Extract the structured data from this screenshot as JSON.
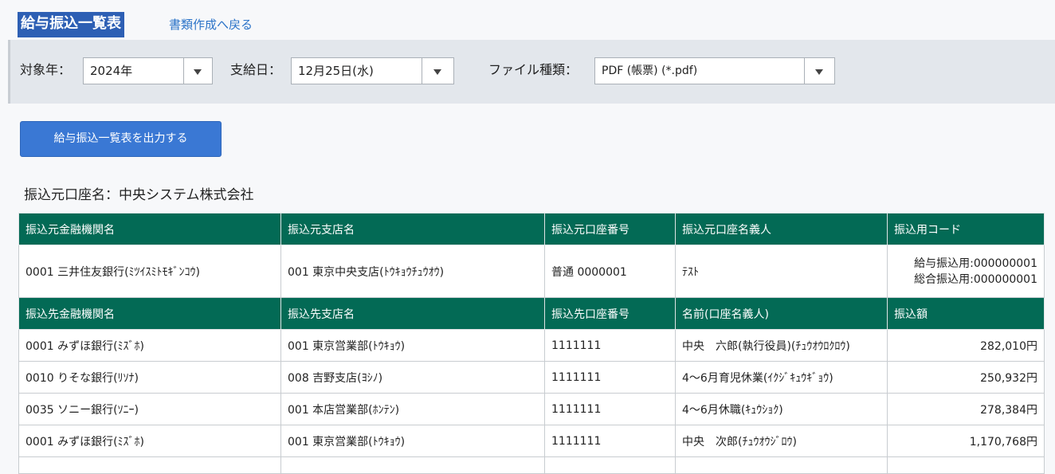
{
  "header": {
    "title": "給与振込一覧表",
    "back_link": "書類作成へ戻る"
  },
  "filters": {
    "year_label": "対象年：",
    "year_value": "2024年",
    "payday_label": "支給日：",
    "payday_value": "12月25日(水)",
    "filetype_label": "ファイル種類：",
    "filetype_value": "PDF (帳票) (*.pdf)"
  },
  "export_button": "給与振込一覧表を出力する",
  "source_account_label": "振込元口座名：中央システム株式会社",
  "source_headers": [
    "振込元金融機関名",
    "振込元支店名",
    "振込元口座番号",
    "振込元口座名義人",
    "振込用コード"
  ],
  "source_row": {
    "bank": "0001 三井住友銀行(ﾐﾂｲｽﾐﾄﾓｷﾞﾝｺｳ)",
    "branch": "001 東京中央支店(ﾄｳｷｮｳﾁｭｳｵｳ)",
    "account_no": "普通 0000001",
    "holder": "ﾃｽﾄ",
    "code_salary": "給与振込用:000000001",
    "code_general": "総合振込用:000000001"
  },
  "dest_headers": [
    "振込先金融機関名",
    "振込先支店名",
    "振込先口座番号",
    "名前(口座名義人)",
    "振込額"
  ],
  "dest_rows": [
    {
      "bank": "0001 みずほ銀行(ﾐｽﾞﾎ)",
      "branch": "001 東京営業部(ﾄｳｷｮｳ)",
      "account_no": "1111111",
      "name": "中央　六郎(執行役員)(ﾁｭｳｵｳﾛｸﾛｳ)",
      "amount": "282,010円"
    },
    {
      "bank": "0010 りそな銀行(ﾘｿﾅ)",
      "branch": "008 吉野支店(ﾖｼﾉ)",
      "account_no": "1111111",
      "name": "4～6月育児休業(ｲｸｼﾞｷｭｳｷﾞｮｳ)",
      "amount": "250,932円"
    },
    {
      "bank": "0035 ソニー銀行(ｿﾆｰ)",
      "branch": "001 本店営業部(ﾎﾝﾃﾝ)",
      "account_no": "1111111",
      "name": "4～6月休職(ｷｭｳｼｮｸ)",
      "amount": "278,384円"
    },
    {
      "bank": "0001 みずほ銀行(ﾐｽﾞﾎ)",
      "branch": "001 東京営業部(ﾄｳｷｮｳ)",
      "account_no": "1111111",
      "name": "中央　次郎(ﾁｭｳｵｳｼﾞﾛｳ)",
      "amount": "1,170,768円"
    }
  ]
}
